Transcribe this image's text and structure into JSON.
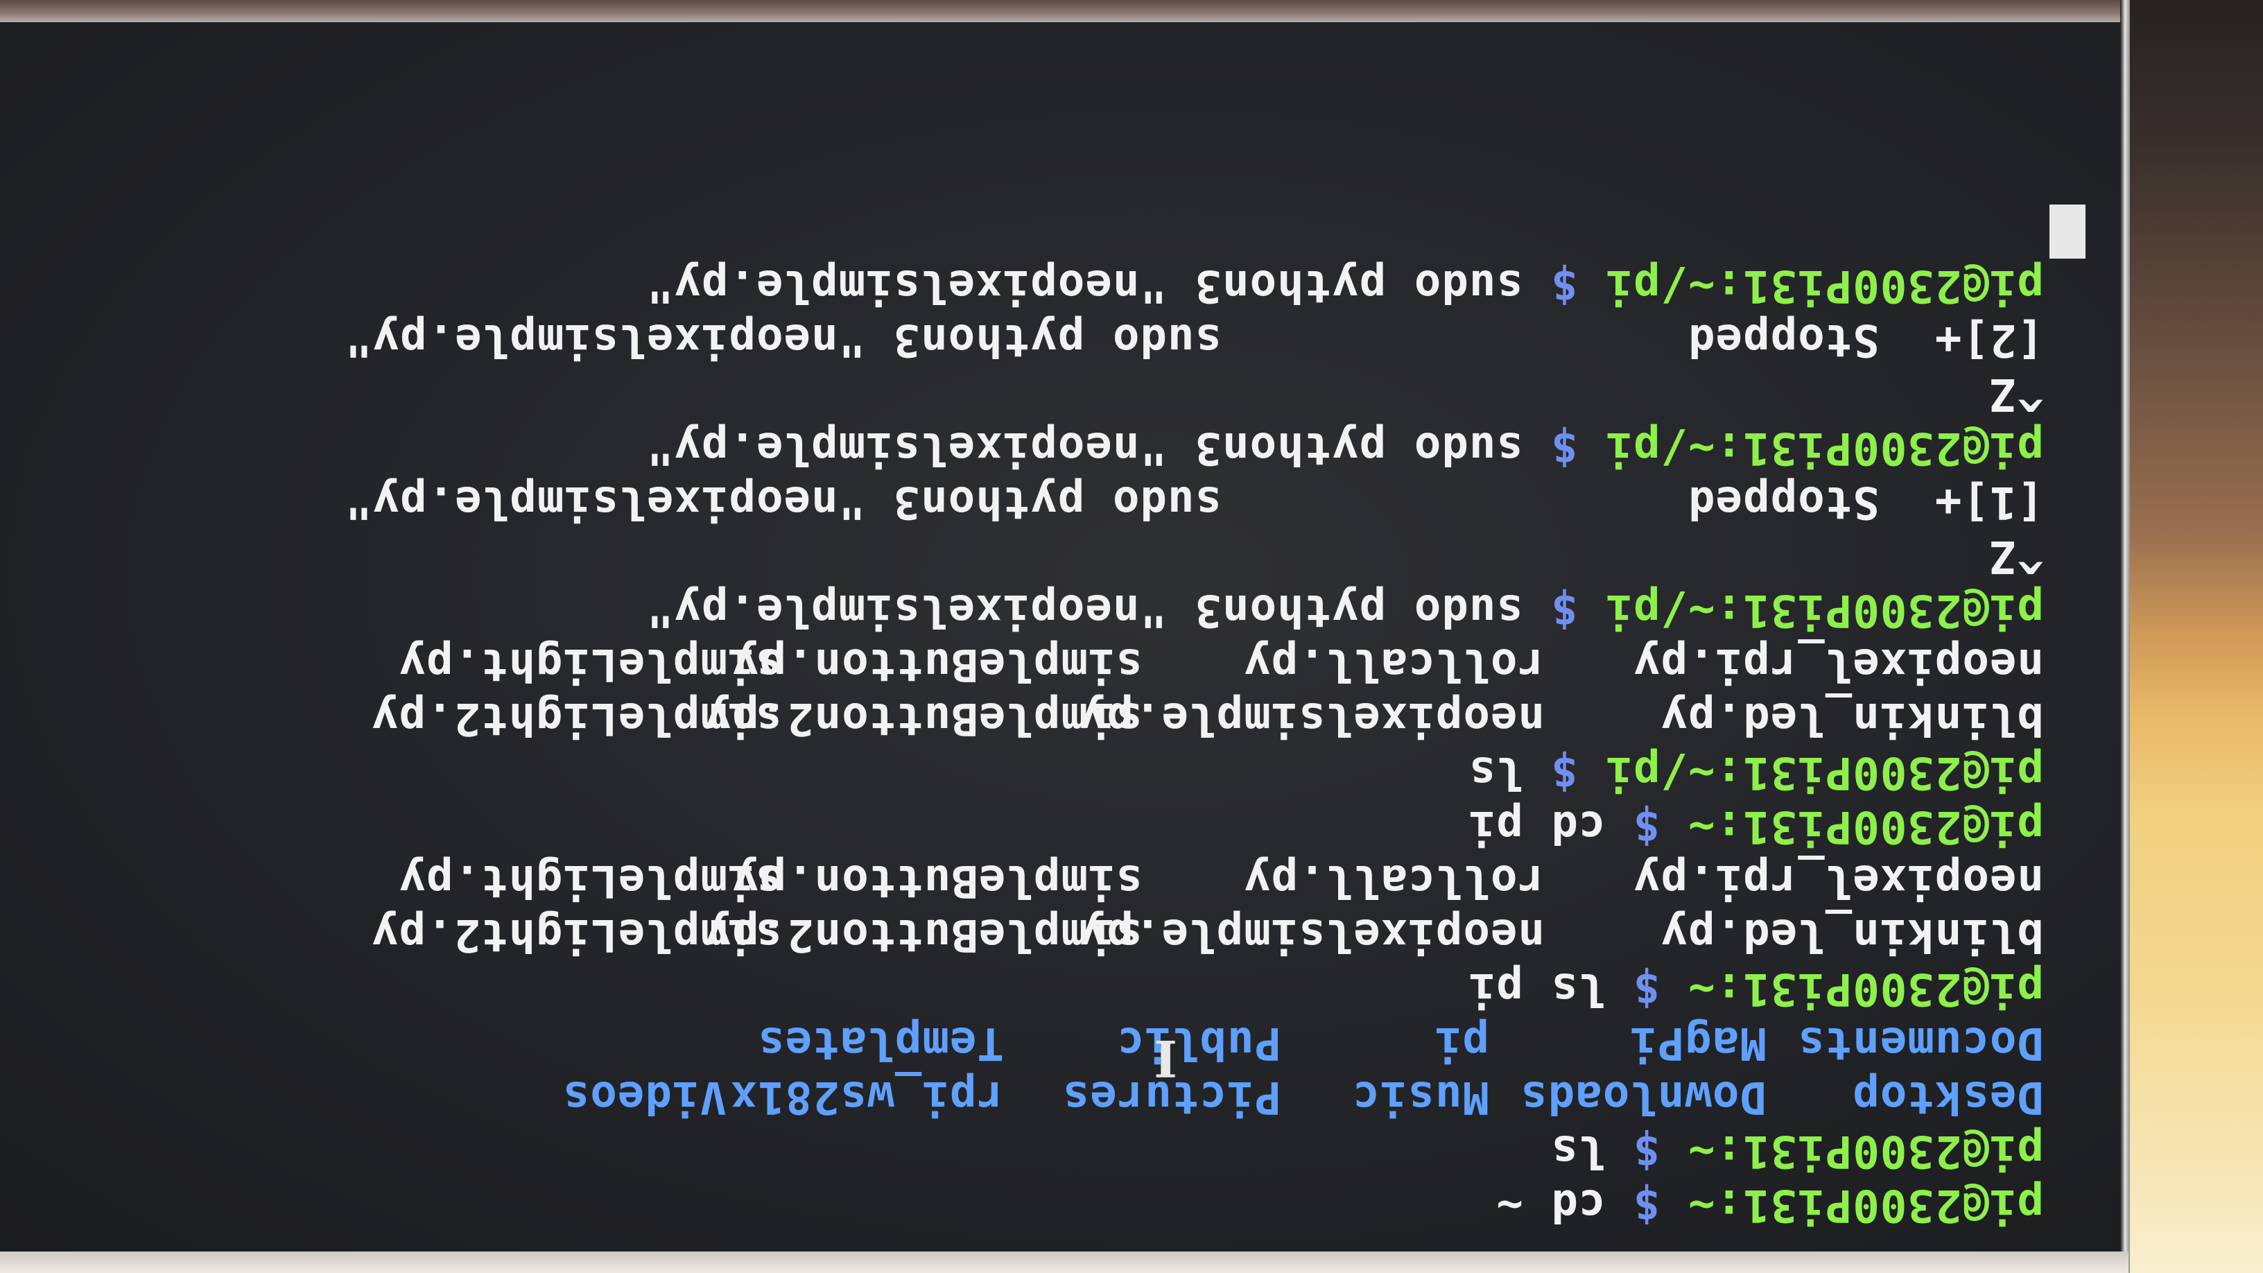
{
  "terminal": {
    "prompt_home": "pi@2300Pi31:~",
    "prompt_pi": "pi@2300Pi31:~/pi",
    "dollar": "$",
    "lines": [
      {
        "kind": "cmd",
        "user": "pi@2300Pi31:~",
        "dollar": "$",
        "text": "cd ~"
      },
      {
        "kind": "cmd",
        "user": "pi@2300Pi31:~",
        "dollar": "$",
        "text": "ls"
      },
      {
        "kind": "dirs",
        "cols": [
          "Desktop",
          "Downloads",
          "Music",
          "Pictures",
          "rpi_ws281x",
          "Videos"
        ]
      },
      {
        "kind": "dirs",
        "cols": [
          "Documents",
          "MagPi",
          "pi",
          "Public",
          "Templates"
        ]
      },
      {
        "kind": "cmd",
        "user": "pi@2300Pi31:~",
        "dollar": "$",
        "text": "ls pi"
      },
      {
        "kind": "files",
        "cols": [
          "blinkin_led.py",
          "neopixelsimple.py",
          "simpleButton2.py",
          "simpleLight2.py"
        ]
      },
      {
        "kind": "files",
        "cols": [
          "neopixel_rpi.py",
          "rollcall.py",
          "simpleButton.py",
          "simpleLight.py"
        ]
      },
      {
        "kind": "cmd",
        "user": "pi@2300Pi31:~",
        "dollar": "$",
        "text": "cd pi"
      },
      {
        "kind": "cmd",
        "user": "pi@2300Pi31:~/pi",
        "dollar": "$",
        "text": "ls"
      },
      {
        "kind": "files",
        "cols": [
          "blinkin_led.py",
          "neopixelsimple.py",
          "simpleButton2.py",
          "simpleLight2.py"
        ]
      },
      {
        "kind": "files",
        "cols": [
          "neopixel_rpi.py",
          "rollcall.py",
          "simpleButton.py",
          "simpleLight.py"
        ]
      },
      {
        "kind": "cmd",
        "user": "pi@2300Pi31:~/pi",
        "dollar": "$",
        "text": "sudo python3 \"neopixelsimple.py\""
      },
      {
        "kind": "text",
        "text": "^Z"
      },
      {
        "kind": "text",
        "text": "[1]+  Stopped                 sudo python3 \"neopixelsimple.py\""
      },
      {
        "kind": "cmd",
        "user": "pi@2300Pi31:~/pi",
        "dollar": "$",
        "text": "sudo python3 \"neopixelsimple.py\""
      },
      {
        "kind": "text",
        "text": "^Z"
      },
      {
        "kind": "text",
        "text": "[2]+  Stopped                 sudo python3 \"neopixelsimple.py\""
      },
      {
        "kind": "cmd",
        "user": "pi@2300Pi31:~/pi",
        "dollar": "$",
        "text": "sudo python3 \"neopixelsimple.py\""
      }
    ],
    "cursor_glyph": "I"
  },
  "colors": {
    "prompt_user": "#8ef04a",
    "prompt_path": "#6f8ff2",
    "directory": "#5fa0ff",
    "text": "#f2f2f2",
    "background": "#25262a"
  }
}
